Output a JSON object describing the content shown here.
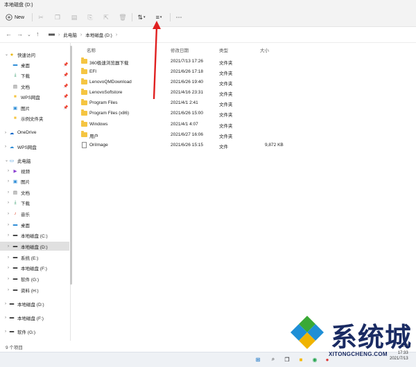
{
  "window": {
    "title": "本地磁盘 (D:)"
  },
  "toolbar": {
    "new_label": "New"
  },
  "address": {
    "crumbs": [
      "此电脑",
      "本地磁盘 (D:)"
    ]
  },
  "columns": {
    "name": "名称",
    "date": "修改日期",
    "type": "类型",
    "size": "大小"
  },
  "files": [
    {
      "name": "360极速浏览器下载",
      "date": "2021/7/13 17:26",
      "type": "文件夹",
      "size": "",
      "kind": "folder"
    },
    {
      "name": "EFI",
      "date": "2021/6/26 17:18",
      "type": "文件夹",
      "size": "",
      "kind": "folder"
    },
    {
      "name": "LenovoQMDownload",
      "date": "2021/6/26 19:40",
      "type": "文件夹",
      "size": "",
      "kind": "folder"
    },
    {
      "name": "LenovoSoftstore",
      "date": "2021/4/16 23:31",
      "type": "文件夹",
      "size": "",
      "kind": "folder"
    },
    {
      "name": "Program Files",
      "date": "2021/4/1 2:41",
      "type": "文件夹",
      "size": "",
      "kind": "folder"
    },
    {
      "name": "Program Files (x86)",
      "date": "2021/6/26 15:00",
      "type": "文件夹",
      "size": "",
      "kind": "folder"
    },
    {
      "name": "Windows",
      "date": "2021/4/1 4:07",
      "type": "文件夹",
      "size": "",
      "kind": "folder"
    },
    {
      "name": "用户",
      "date": "2021/6/27 16:06",
      "type": "文件夹",
      "size": "",
      "kind": "folder"
    },
    {
      "name": "OriImage",
      "date": "2021/6/26 15:15",
      "type": "文件",
      "size": "9,872 KB",
      "kind": "file"
    }
  ],
  "sidebar": {
    "quick_access": "快速访问",
    "quick_items": [
      "桌面",
      "下载",
      "文档",
      "WPS网盘",
      "图片",
      "示例文件夹"
    ],
    "onedrive": "OneDrive",
    "wps": "WPS网盘",
    "this_pc": "此电脑",
    "pc_items": [
      "视频",
      "图片",
      "文档",
      "下载",
      "音乐",
      "桌面",
      "本地磁盘 (C:)",
      "本地磁盘 (D:)",
      "系统 (E:)",
      "本地磁盘 (F:)",
      "软件 (G:)",
      "资料 (H:)"
    ],
    "bottom_items": [
      "本地磁盘 (D:)",
      "本地磁盘 (F:)",
      "软件 (G:)"
    ]
  },
  "status": {
    "count": "9 个项目"
  },
  "watermark": {
    "text": "系统城",
    "url": "XITONGCHENG.COM"
  },
  "taskbar": {
    "time": "2021/7/13",
    "clock": "17:33"
  },
  "colors": {
    "folder": "#f5c542",
    "accent": "#0067c0",
    "arrow": "#e02020",
    "watermark": "#1a2b63"
  }
}
